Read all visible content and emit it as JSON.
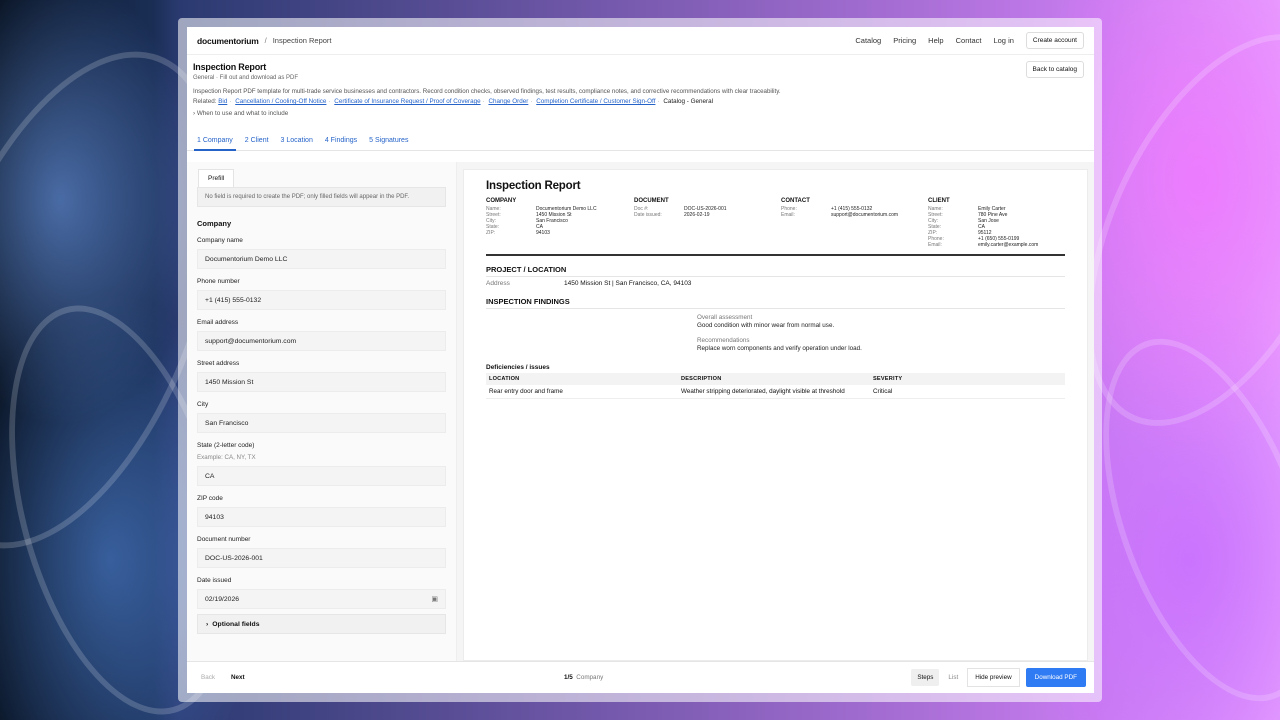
{
  "nav": {
    "brand": "documentorium",
    "separator": "/",
    "crumb": "Inspection Report",
    "links": [
      "Catalog",
      "Pricing",
      "Help",
      "Contact",
      "Log in"
    ],
    "create_account": "Create account"
  },
  "header": {
    "title": "Inspection Report",
    "subtitle": "General · Fill out and download as PDF",
    "description": "Inspection Report PDF template for multi-trade service businesses and contractors. Record condition checks, observed findings, test results, compliance notes, and corrective recommendations with clear traceability.",
    "related_label": "Related:",
    "related_links": [
      "Bid",
      "Cancellation / Cooling-Off Notice",
      "Certificate of Insurance Request / Proof of Coverage",
      "Change Order",
      "Completion Certificate / Customer Sign-Off"
    ],
    "catalog_text": "Catalog - General",
    "when_toggle": "When to use and what to include",
    "back_button": "Back to catalog"
  },
  "tabs": [
    "1 Company",
    "2 Client",
    "3 Location",
    "4 Findings",
    "5 Signatures"
  ],
  "form": {
    "prefill_tab": "Prefill",
    "note": "No field is required to create the PDF; only filled fields will appear in the PDF.",
    "section_title": "Company",
    "fields": {
      "company_name": {
        "label": "Company name",
        "value": "Documentorium Demo LLC"
      },
      "phone": {
        "label": "Phone number",
        "value": "+1 (415) 555-0132"
      },
      "email": {
        "label": "Email address",
        "value": "support@documentorium.com"
      },
      "street": {
        "label": "Street address",
        "value": "1450 Mission St"
      },
      "city": {
        "label": "City",
        "value": "San Francisco"
      },
      "state": {
        "label": "State (2-letter code)",
        "hint": "Example: CA, NY, TX",
        "value": "CA"
      },
      "zip": {
        "label": "ZIP code",
        "value": "94103"
      },
      "doc_number": {
        "label": "Document number",
        "value": "DOC-US-2026-001"
      },
      "date_issued": {
        "label": "Date issued",
        "value": "02/19/2026"
      }
    },
    "optional_fields": "Optional fields"
  },
  "preview": {
    "title": "Inspection Report",
    "company": {
      "heading": "COMPANY",
      "rows": [
        [
          "Name:",
          "Documentorium Demo LLC"
        ],
        [
          "Street:",
          "1450 Mission St"
        ],
        [
          "City:",
          "San Francisco"
        ],
        [
          "State:",
          "CA"
        ],
        [
          "ZIP:",
          "94103"
        ]
      ]
    },
    "document": {
      "heading": "DOCUMENT",
      "rows": [
        [
          "Doc #:",
          "DOC-US-2026-001"
        ],
        [
          "Date issued:",
          "2026-02-19"
        ]
      ]
    },
    "contact": {
      "heading": "CONTACT",
      "rows": [
        [
          "Phone:",
          "+1 (415) 555-0132"
        ],
        [
          "Email:",
          "support@documentorium.com"
        ]
      ]
    },
    "client": {
      "heading": "CLIENT",
      "rows": [
        [
          "Name:",
          "Emily Carter"
        ],
        [
          "Street:",
          "780 Pine Ave"
        ],
        [
          "City:",
          "San Jose"
        ],
        [
          "State:",
          "CA"
        ],
        [
          "ZIP:",
          "95112"
        ],
        [
          "Phone:",
          "+1 (650) 555-0199"
        ],
        [
          "Email:",
          "emily.carter@example.com"
        ]
      ]
    },
    "project_heading": "PROJECT / LOCATION",
    "address_label": "Address",
    "address_value": "1450 Mission St | San Francisco, CA, 94103",
    "findings_heading": "INSPECTION FINDINGS",
    "overall_label": "Overall assessment",
    "overall_value": "Good condition with minor wear from normal use.",
    "recs_label": "Recommendations",
    "recs_value": "Replace worn components and verify operation under load.",
    "deficiencies_heading": "Deficiencies / issues",
    "table_headers": [
      "LOCATION",
      "DESCRIPTION",
      "SEVERITY"
    ],
    "table_rows": [
      [
        "Rear entry door and frame",
        "Weather stripping deteriorated, daylight visible at threshold",
        "Critical"
      ]
    ]
  },
  "bottom": {
    "back": "Back",
    "next": "Next",
    "progress": "1/5",
    "progress_label": "Company",
    "steps": "Steps",
    "list": "List",
    "hide_preview": "Hide preview",
    "download": "Download PDF"
  }
}
